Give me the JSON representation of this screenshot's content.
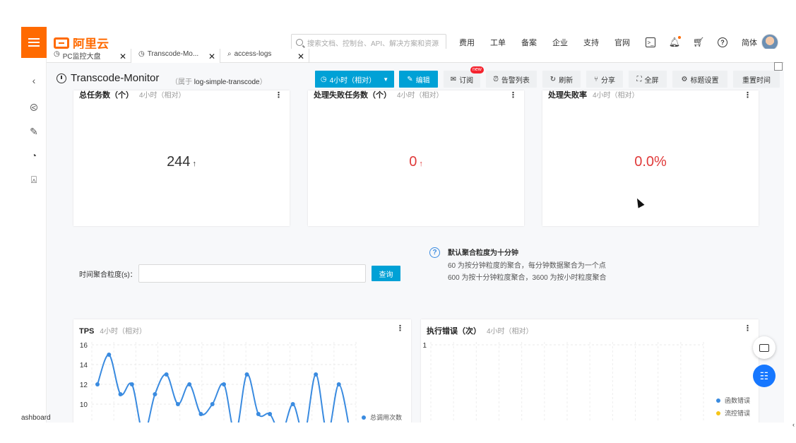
{
  "brand": {
    "name": "阿里云",
    "accent": "#ff6a00"
  },
  "topnav": {
    "search_placeholder": "搜索文档、控制台、API、解决方案和资源",
    "links": [
      "费用",
      "工单",
      "备案",
      "企业",
      "支持",
      "官网"
    ],
    "language": "简体",
    "icons": [
      "terminal-icon",
      "bell-icon",
      "cart-icon",
      "help-icon"
    ]
  },
  "sidebar": {
    "icons": [
      "back-arrow-icon",
      "monitor-chart-icon",
      "edit-doc-icon",
      "pie-chart-icon",
      "router-icon"
    ],
    "bottom_label": "ashboard"
  },
  "tabs": [
    {
      "label": "PC监控大盘",
      "icon": "clock-icon"
    },
    {
      "label": "Transcode-Mo...",
      "icon": "clock-icon"
    },
    {
      "label": "access-logs",
      "icon": "search-chart-icon"
    }
  ],
  "dashboard": {
    "title": "Transcode-Monitor",
    "belongs_prefix": "属于",
    "logstore": "log-simple-transcode",
    "toolbar": {
      "time_range": "4小时（相对）",
      "edit": "编辑",
      "subscribe": "订阅",
      "subscribe_badge": "new",
      "alerts": "告警列表",
      "refresh": "刷新",
      "share": "分享",
      "fullscreen": "全屏",
      "title_settings": "标题设置",
      "reset_time": "重置时间"
    }
  },
  "stats": [
    {
      "title": "总任务数（个）",
      "range": "4小时（相对）",
      "value": "244",
      "arrow": "↑",
      "color": "#333333"
    },
    {
      "title": "处理失败任务数（个）",
      "range": "4小时（相对）",
      "value": "0",
      "arrow": "↑",
      "color": "#e03a3a"
    },
    {
      "title": "处理失败率",
      "range": "4小时（相对）",
      "value": "0.0%",
      "arrow": "",
      "color": "#e03a3a"
    }
  ],
  "aggregation": {
    "label": "时间聚合粒度(s)：",
    "input_value": "",
    "query_button": "查询",
    "hint_title": "默认聚合粒度为十分钟",
    "hint_line1": "60 为按分钟粒度的聚合，每分钟数据聚合为一个点",
    "hint_line2": "600 为按十分钟粒度聚合，3600 为按小时粒度聚合"
  },
  "panels": {
    "tps": {
      "title": "TPS",
      "range": "4小时（相对）",
      "legend": "总调用次数"
    },
    "errors": {
      "title": "执行错误（次）",
      "range": "4小时（相对）",
      "legend_1": "函数错误",
      "legend_2": "流控错误"
    }
  },
  "chart_data": [
    {
      "type": "line",
      "title": "TPS",
      "y_ticks": [
        10,
        12,
        14,
        16
      ],
      "ylim": [
        8,
        16
      ],
      "series": [
        {
          "name": "总调用次数",
          "color": "#3a8be0",
          "values": [
            12,
            15,
            11,
            12,
            7,
            11,
            13,
            10,
            12,
            9,
            10,
            12,
            7,
            13,
            9,
            9,
            7,
            10,
            7,
            13,
            7,
            12,
            7
          ]
        }
      ],
      "grid": true,
      "legend_position": "right"
    },
    {
      "type": "line",
      "title": "执行错误（次）",
      "y_ticks": [
        1
      ],
      "ylim": [
        0,
        1
      ],
      "series": [
        {
          "name": "函数错误",
          "color": "#3a8be0",
          "values": []
        },
        {
          "name": "流控错误",
          "color": "#f5c518",
          "values": []
        }
      ],
      "grid": true,
      "legend_position": "right"
    }
  ]
}
